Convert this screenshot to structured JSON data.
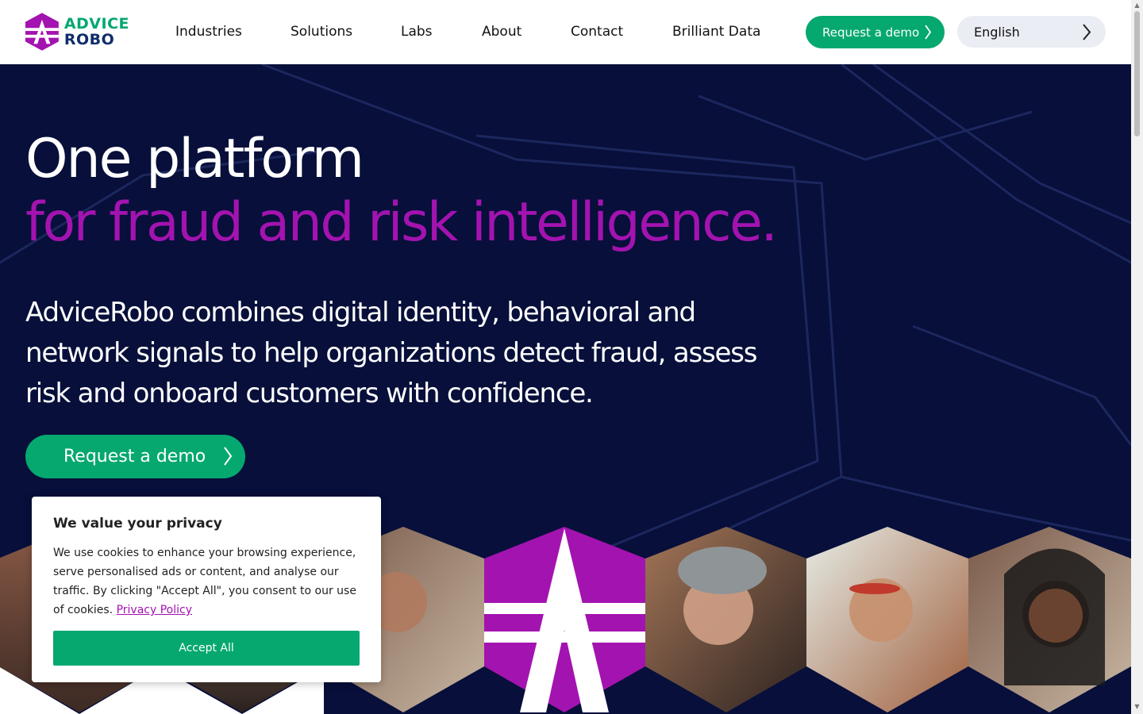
{
  "header": {
    "logo": {
      "line1": "ADVICE",
      "line2": "ROBO"
    },
    "nav": [
      {
        "label": "Industries"
      },
      {
        "label": "Solutions"
      },
      {
        "label": "Labs"
      },
      {
        "label": "About"
      },
      {
        "label": "Contact"
      },
      {
        "label": "Brilliant Data"
      }
    ],
    "demo_button": "Request a demo",
    "language": "English"
  },
  "hero": {
    "title_line1": "One platform",
    "title_line2": "for fraud and risk intelligence.",
    "subtitle": "AdviceRobo combines digital identity, behavioral and network signals to help organizations detect fraud, assess risk and onboard customers with confidence.",
    "demo_button": "Request a demo"
  },
  "cookie_banner": {
    "title": "We value your privacy",
    "body": "We use cookies to enhance your browsing experience, serve personalised ads or content, and analyse our traffic. By clicking \"Accept All\", you consent to our use of cookies.",
    "privacy_link": "Privacy Policy",
    "accept_button": "Accept All"
  },
  "colors": {
    "brand_green": "#05a86f",
    "brand_purple": "#a313b0",
    "hero_bg": "#070f3a",
    "logo_blue": "#0f2d6b"
  },
  "icons": [
    "logo-icon",
    "chevron-right-icon",
    "scroll-up-icon",
    "scroll-down-icon"
  ]
}
